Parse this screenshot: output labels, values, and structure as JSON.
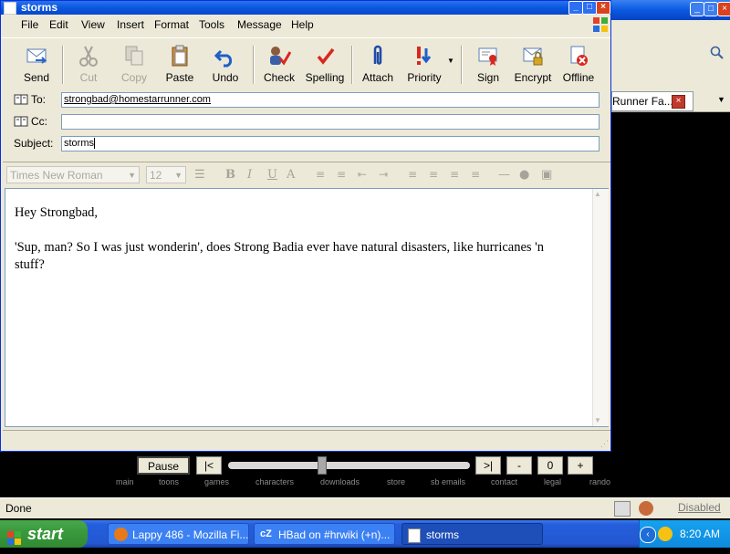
{
  "compose_window": {
    "title": "storms",
    "menu": [
      "File",
      "Edit",
      "View",
      "Insert",
      "Format",
      "Tools",
      "Message",
      "Help"
    ],
    "toolbar": {
      "send": "Send",
      "cut": "Cut",
      "copy": "Copy",
      "paste": "Paste",
      "undo": "Undo",
      "check": "Check",
      "spelling": "Spelling",
      "attach": "Attach",
      "priority": "Priority",
      "sign": "Sign",
      "encrypt": "Encrypt",
      "offline": "Offline"
    },
    "headers": {
      "to_label": "To:",
      "to_value": "strongbad@homestarrunner.com",
      "cc_label": "Cc:",
      "cc_value": "",
      "subject_label": "Subject:",
      "subject_value": "storms"
    },
    "format": {
      "font": "Times New Roman",
      "size": "12"
    },
    "message": {
      "greeting": "Hey Strongbad,",
      "body": "'Sup, man? So I was just wonderin', does Strong Badia ever have natural disasters, like hurricanes 'n stuff?"
    }
  },
  "player": {
    "pause": "Pause",
    "prev": "|<",
    "next": ">|",
    "minus": "-",
    "counter": "0",
    "plus": "+",
    "nav": [
      "main",
      "toons",
      "games",
      "characters",
      "downloads",
      "store",
      "sb emails",
      "contact",
      "legal",
      "rando"
    ]
  },
  "background_browser": {
    "tab_label": "Runner Fa..."
  },
  "browser_status": {
    "text": "Done",
    "disabled_label": "Disabled"
  },
  "taskbar": {
    "start": "start",
    "tasks": [
      "Lappy 486 - Mozilla Fi...",
      "HBad on #hrwiki (+n)...",
      "storms"
    ],
    "clock": "8:20 AM"
  },
  "colors": {
    "title_blue": "#0a57e0",
    "chrome": "#ece9d8",
    "start_green": "#3c9a3e",
    "taskbar_blue": "#245edb"
  }
}
